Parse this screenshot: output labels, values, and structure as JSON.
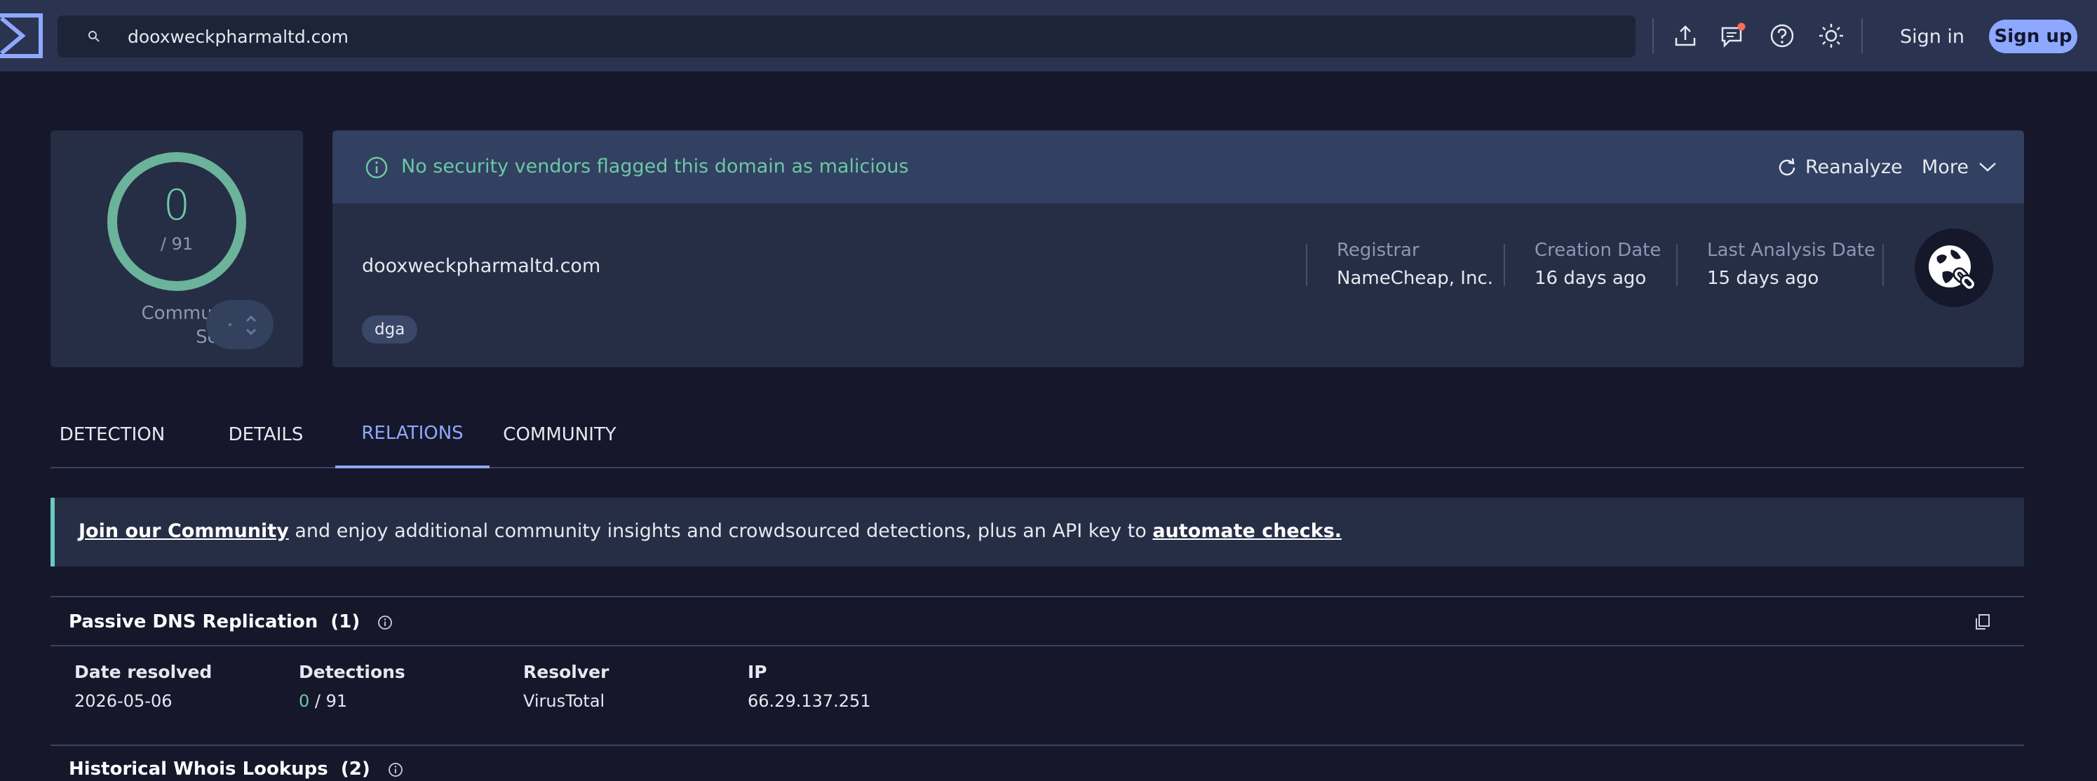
{
  "search": {
    "value": "dooxweckpharmaltd.com"
  },
  "header": {
    "signin_label": "Sign in",
    "signup_label": "Sign up"
  },
  "icons": {
    "logo": "virustotal-sigma-icon",
    "search": "search-icon",
    "upload": "upload-icon",
    "notifications": "chat-notification-icon",
    "help": "help-icon",
    "theme": "sun-icon",
    "reanalyze": "refresh-icon",
    "more": "chevron-down-icon",
    "info": "info-icon",
    "copy": "copy-icon",
    "domain_avatar": "globe-link-icon"
  },
  "colors": {
    "accent": "#8ea8ff",
    "clean": "#6cc8a2",
    "notification_dot": "#ff6b5b"
  },
  "score": {
    "detections": "0",
    "total": "/ 91",
    "community_label_line1": "Community",
    "community_label_line2": "Score"
  },
  "summary": {
    "banner_text": "No security vendors flagged this domain as malicious",
    "reanalyze_label": "Reanalyze",
    "more_label": "More",
    "domain": "dooxweckpharmaltd.com",
    "tags": [
      "dga"
    ],
    "registrar_label": "Registrar",
    "registrar_value": "NameCheap, Inc.",
    "creation_label": "Creation Date",
    "creation_value": "16 days ago",
    "last_analysis_label": "Last Analysis Date",
    "last_analysis_value": "15 days ago"
  },
  "tabs": [
    {
      "label": "DETECTION",
      "active": false
    },
    {
      "label": "DETAILS",
      "active": false
    },
    {
      "label": "RELATIONS",
      "active": true
    },
    {
      "label": "COMMUNITY",
      "active": false
    }
  ],
  "community_banner": {
    "link1": "Join our Community",
    "middle": " and enjoy additional community insights and crowdsourced detections, plus an API key to ",
    "link2": "automate checks."
  },
  "passive_dns": {
    "title": "Passive DNS Replication",
    "count": "(1)",
    "columns": [
      "Date resolved",
      "Detections",
      "Resolver",
      "IP"
    ],
    "rows": [
      {
        "date": "2026-05-06",
        "detections": "0",
        "detections_total": " / 91",
        "resolver": "VirusTotal",
        "ip": "66.29.137.251"
      }
    ]
  },
  "whois": {
    "title": "Historical Whois Lookups",
    "count": "(2)"
  }
}
